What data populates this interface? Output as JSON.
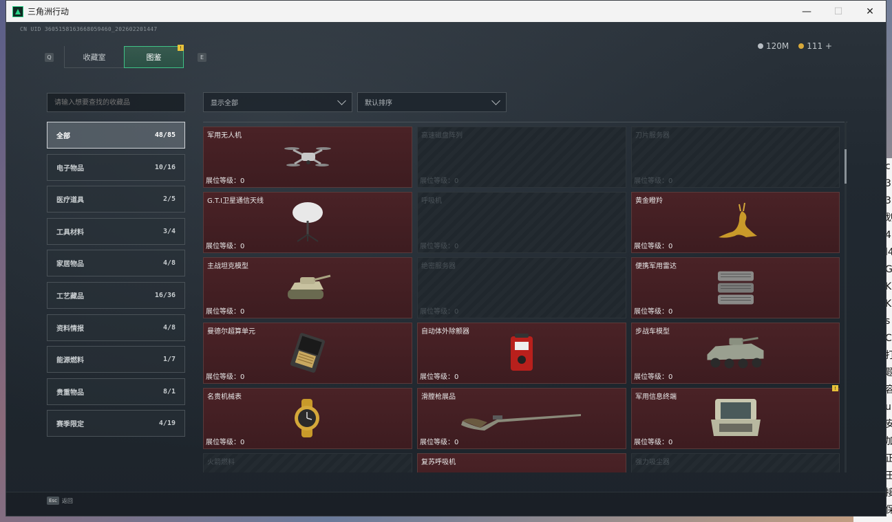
{
  "window": {
    "title": "三角洲行动",
    "minimize": "—",
    "maximize": "☐",
    "close": "✕"
  },
  "header": {
    "uid": "CN UID 3605158163668059460_202602201447",
    "tab_left_key": "Q",
    "tab_right_key": "E",
    "tabs": [
      {
        "label": "收藏室"
      },
      {
        "label": "图鉴",
        "badge": "!"
      }
    ],
    "currency": [
      {
        "value": "120M",
        "icon": "silver-coin-icon"
      },
      {
        "value": "111 +",
        "icon": "gold-coin-icon"
      }
    ]
  },
  "search": {
    "placeholder": "请输入想要查找的收藏品"
  },
  "filters": {
    "display": "显示全部",
    "sort": "默认排序"
  },
  "categories": [
    {
      "label": "全部",
      "count": "48/85",
      "active": true
    },
    {
      "label": "电子物品",
      "count": "10/16"
    },
    {
      "label": "医疗道具",
      "count": "2/5"
    },
    {
      "label": "工具材料",
      "count": "3/4"
    },
    {
      "label": "家居物品",
      "count": "4/8"
    },
    {
      "label": "工艺藏品",
      "count": "16/36"
    },
    {
      "label": "资料情报",
      "count": "4/8"
    },
    {
      "label": "能源燃料",
      "count": "1/7"
    },
    {
      "label": "贵重物品",
      "count": "8/1"
    },
    {
      "label": "赛季限定",
      "count": "4/19"
    }
  ],
  "items": [
    {
      "name": "军用无人机",
      "level": "展位等级：0",
      "locked": false,
      "icon": "drone-icon"
    },
    {
      "name": "高速磁盘阵列",
      "level": "展位等级：0",
      "locked": true,
      "icon": "disk-array-icon"
    },
    {
      "name": "刀片服务器",
      "level": "展位等级：0",
      "locked": true,
      "icon": "blade-server-icon"
    },
    {
      "name": "G.T.I卫星通信天线",
      "level": "展位等级：0",
      "locked": false,
      "icon": "satellite-dish-icon"
    },
    {
      "name": "呼吸机",
      "level": "展位等级：0",
      "locked": true,
      "icon": "ventilator-icon"
    },
    {
      "name": "黄金瞪羚",
      "level": "展位等级：0",
      "locked": false,
      "icon": "golden-gazelle-icon"
    },
    {
      "name": "主战坦克模型",
      "level": "展位等级：0",
      "locked": false,
      "icon": "tank-model-icon"
    },
    {
      "name": "绝密服务器",
      "level": "展位等级：0",
      "locked": true,
      "icon": "secret-server-icon"
    },
    {
      "name": "便携军用雷达",
      "level": "展位等级：0",
      "locked": false,
      "icon": "radar-icon"
    },
    {
      "name": "曼德尔超算单元",
      "level": "展位等级：0",
      "locked": false,
      "icon": "supercomputer-unit-icon"
    },
    {
      "name": "自动体外除颤器",
      "level": "展位等级：0",
      "locked": false,
      "icon": "defibrillator-icon"
    },
    {
      "name": "步战车模型",
      "level": "展位等级：0",
      "locked": false,
      "icon": "ifv-model-icon"
    },
    {
      "name": "名贵机械表",
      "level": "展位等级：0",
      "locked": false,
      "icon": "watch-icon"
    },
    {
      "name": "滑膛枪展品",
      "level": "展位等级：0",
      "locked": false,
      "icon": "musket-icon"
    },
    {
      "name": "军用信息终端",
      "level": "展位等级：0",
      "locked": false,
      "icon": "terminal-icon",
      "badge": "!"
    },
    {
      "name": "火箭燃料",
      "level": "",
      "locked": true,
      "icon": "rocket-fuel-icon"
    },
    {
      "name": "复苏呼吸机",
      "level": "",
      "locked": false,
      "icon": "resuscitator-icon"
    },
    {
      "name": "强力吸尘器",
      "level": "",
      "locked": true,
      "icon": "vacuum-icon"
    }
  ],
  "footer": {
    "esc_key": "Esc",
    "esc_label": "返回"
  },
  "background": {
    "strip_chars": [
      "c",
      "3",
      "3",
      "划",
      "4",
      "l4",
      "G",
      "K",
      "K",
      "s",
      "C",
      "打",
      "题",
      "容",
      "u",
      "安",
      "加",
      "正",
      "王",
      "接",
      "保"
    ]
  }
}
